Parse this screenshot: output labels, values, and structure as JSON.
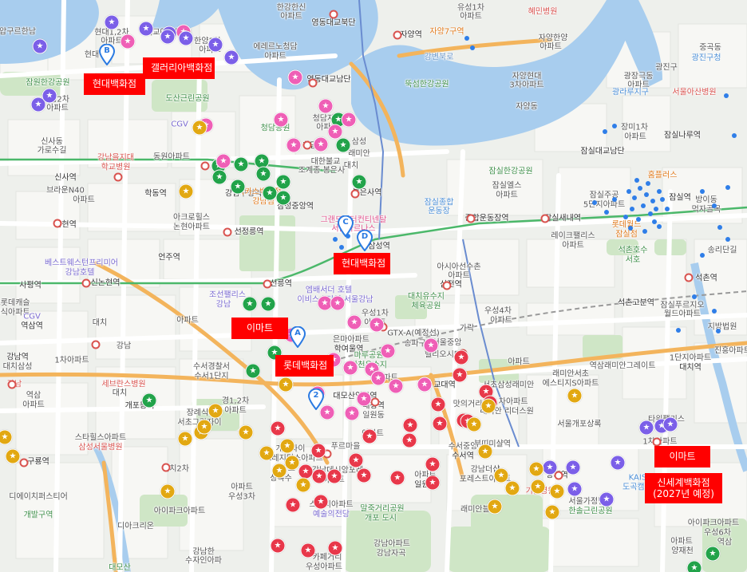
{
  "colors": {
    "land": "#eef0ec",
    "block": "#f6f6f3",
    "river": "#a8cdee",
    "park": "#cfe6c6",
    "road_major": "#ffffff",
    "road_orange": "#f3b45c",
    "line_green": "#4bb86a",
    "marker_green": "#22a34a",
    "marker_pink": "#ef5fb6",
    "marker_purple": "#7b5fe8",
    "marker_red": "#e8384a",
    "marker_yellow": "#e2a812",
    "callout_red": "#ff0000"
  },
  "callouts": [
    {
      "name": "callout-hyundai-apgujeong",
      "text": "현대백화점"
    },
    {
      "name": "callout-galleria",
      "text": "갤러리아백화점"
    },
    {
      "name": "callout-hyundai-coex",
      "text": "현대백화점"
    },
    {
      "name": "callout-emart-daechi",
      "text": "이마트"
    },
    {
      "name": "callout-lotte",
      "text": "롯데백화점"
    },
    {
      "name": "callout-emart-suseo",
      "text": "이마트"
    },
    {
      "name": "callout-shinsegae",
      "text": "신세계백화점\n(2027년 예정)"
    }
  ],
  "pins": [
    {
      "name": "pin-a",
      "letter": "A"
    },
    {
      "name": "pin-b",
      "letter": "B"
    },
    {
      "name": "pin-c",
      "letter": "C"
    },
    {
      "name": "pin-d",
      "letter": "D"
    },
    {
      "name": "pin-2",
      "letter": "2"
    }
  ],
  "marker_icon": "star-icon",
  "labels": [
    {
      "text": "압구르한남",
      "cls": ""
    },
    {
      "text": "현대1,2차",
      "cls": ""
    },
    {
      "text": "아파트",
      "cls": ""
    },
    {
      "text": "현대",
      "cls": ""
    },
    {
      "text": "대교아파트",
      "cls": ""
    },
    {
      "text": "한양1차",
      "cls": ""
    },
    {
      "text": "아파트",
      "cls": ""
    },
    {
      "text": "에레르노청담",
      "cls": ""
    },
    {
      "text": "아파트",
      "cls": ""
    },
    {
      "text": "한강한신",
      "cls": ""
    },
    {
      "text": "아파트",
      "cls": ""
    },
    {
      "text": "영동대교북단",
      "cls": "station"
    },
    {
      "text": "영동대교남단",
      "cls": "station"
    },
    {
      "text": "자양역",
      "cls": "station"
    },
    {
      "text": "자양7구역",
      "cls": "orange"
    },
    {
      "text": "유성1차",
      "cls": ""
    },
    {
      "text": "아파트",
      "cls": ""
    },
    {
      "text": "혜민병원",
      "cls": "hosp"
    },
    {
      "text": "자양한양",
      "cls": ""
    },
    {
      "text": "아파트",
      "cls": ""
    },
    {
      "text": "강변북로",
      "cls": "river"
    },
    {
      "text": "뚝섬한강공원",
      "cls": "park"
    },
    {
      "text": "자양현대",
      "cls": ""
    },
    {
      "text": "3차아파트",
      "cls": ""
    },
    {
      "text": "자양동",
      "cls": ""
    },
    {
      "text": "중곡동",
      "cls": ""
    },
    {
      "text": "광진구청",
      "cls": "area"
    },
    {
      "text": "광진구",
      "cls": ""
    },
    {
      "text": "광장극동",
      "cls": ""
    },
    {
      "text": "아파트",
      "cls": ""
    },
    {
      "text": "광라루지구",
      "cls": "area"
    },
    {
      "text": "서울아산병원",
      "cls": "hosp"
    },
    {
      "text": "잠원한강공원",
      "cls": "park"
    },
    {
      "text": "미성2차",
      "cls": ""
    },
    {
      "text": "아파트",
      "cls": ""
    },
    {
      "text": "도산근린공원",
      "cls": "park"
    },
    {
      "text": "신사동",
      "cls": ""
    },
    {
      "text": "가로수길",
      "cls": ""
    },
    {
      "text": "CGV",
      "cls": "purple"
    },
    {
      "text": "청담공원",
      "cls": "park"
    },
    {
      "text": "청담자이",
      "cls": ""
    },
    {
      "text": "아파트",
      "cls": ""
    },
    {
      "text": "청담역",
      "cls": "station"
    },
    {
      "text": "삼성",
      "cls": ""
    },
    {
      "text": "래미안",
      "cls": ""
    },
    {
      "text": "대치",
      "cls": ""
    },
    {
      "text": "장미1차",
      "cls": ""
    },
    {
      "text": "아파트",
      "cls": ""
    },
    {
      "text": "잠실나루역",
      "cls": "station"
    },
    {
      "text": "잠실대교남단",
      "cls": "station"
    },
    {
      "text": "잠실한강공원",
      "cls": "park"
    },
    {
      "text": "강남을지대",
      "cls": "hosp"
    },
    {
      "text": "학교병원",
      "cls": "hosp"
    },
    {
      "text": "동원아파트",
      "cls": ""
    },
    {
      "text": "대한불교",
      "cls": ""
    },
    {
      "text": "조계종 봉은사",
      "cls": ""
    },
    {
      "text": "홈플러스",
      "cls": "orange"
    },
    {
      "text": "잠실엘스",
      "cls": ""
    },
    {
      "text": "아파트",
      "cls": ""
    },
    {
      "text": "잠실주공",
      "cls": ""
    },
    {
      "text": "5단지아파트",
      "cls": ""
    },
    {
      "text": "잠실역",
      "cls": "station"
    },
    {
      "text": "방이동",
      "cls": ""
    },
    {
      "text": "먹자골목",
      "cls": ""
    },
    {
      "text": "신사역",
      "cls": "station"
    },
    {
      "text": "학동역",
      "cls": "station"
    },
    {
      "text": "강남구청역",
      "cls": "station"
    },
    {
      "text": "봉은사역",
      "cls": "station"
    },
    {
      "text": "잠실종합",
      "cls": "area"
    },
    {
      "text": "운동장",
      "cls": "area"
    },
    {
      "text": "종합운동장역",
      "cls": "station"
    },
    {
      "text": "잠실새내역",
      "cls": "station"
    },
    {
      "text": "브라운N40",
      "cls": ""
    },
    {
      "text": "아파트",
      "cls": ""
    },
    {
      "text": "카카스백화점",
      "cls": "orange"
    },
    {
      "text": "강남점",
      "cls": "orange"
    },
    {
      "text": "삼성중앙역",
      "cls": "station"
    },
    {
      "text": "그랜드인터컨티넨탈",
      "cls": "pink"
    },
    {
      "text": "서울파르나스",
      "cls": "pink"
    },
    {
      "text": "레이크팰리스",
      "cls": ""
    },
    {
      "text": "아파트",
      "cls": ""
    },
    {
      "text": "롯데월드",
      "cls": "orange"
    },
    {
      "text": "잠실점",
      "cls": "orange"
    },
    {
      "text": "논현역",
      "cls": "station"
    },
    {
      "text": "아크로힐스",
      "cls": ""
    },
    {
      "text": "논현아파트",
      "cls": ""
    },
    {
      "text": "선정릉역",
      "cls": "station"
    },
    {
      "text": "삼성역",
      "cls": "station"
    },
    {
      "text": "송리단길",
      "cls": ""
    },
    {
      "text": "석촌호수",
      "cls": "park"
    },
    {
      "text": "서호",
      "cls": "park"
    },
    {
      "text": "베스트웨스턴프리미어",
      "cls": "purple"
    },
    {
      "text": "강남호텔",
      "cls": "purple"
    },
    {
      "text": "언주역",
      "cls": "station"
    },
    {
      "text": "아시아선수촌",
      "cls": ""
    },
    {
      "text": "아파트",
      "cls": ""
    },
    {
      "text": "신논현역",
      "cls": "station"
    },
    {
      "text": "선릉역",
      "cls": "station"
    },
    {
      "text": "엠배서더 호텔",
      "cls": "purple"
    },
    {
      "text": "이비스스타일 서울강남",
      "cls": "purple"
    },
    {
      "text": "삼전역",
      "cls": "station"
    },
    {
      "text": "석촌역",
      "cls": "station"
    },
    {
      "text": "사평역",
      "cls": "station"
    },
    {
      "text": "조선팰리스",
      "cls": "purple"
    },
    {
      "text": "강남",
      "cls": "purple"
    },
    {
      "text": "대치유수지",
      "cls": "park"
    },
    {
      "text": "체육공원",
      "cls": "park"
    },
    {
      "text": "우성4차",
      "cls": ""
    },
    {
      "text": "아파트",
      "cls": ""
    },
    {
      "text": "석촌고분역",
      "cls": "station"
    },
    {
      "text": "잠실푸르지오",
      "cls": ""
    },
    {
      "text": "월드아파트",
      "cls": ""
    },
    {
      "text": "서초롯데캐슬",
      "cls": ""
    },
    {
      "text": "클래식아파트",
      "cls": ""
    },
    {
      "text": "CGV",
      "cls": "purple"
    },
    {
      "text": "역삼역",
      "cls": "station"
    },
    {
      "text": "대치",
      "cls": ""
    },
    {
      "text": "아파트",
      "cls": ""
    },
    {
      "text": "우성1차",
      "cls": ""
    },
    {
      "text": "아파트",
      "cls": ""
    },
    {
      "text": "GTX-A(예정선)",
      "cls": ""
    },
    {
      "text": "송파구",
      "cls": ""
    },
    {
      "text": "가락",
      "cls": ""
    },
    {
      "text": "서울중앙",
      "cls": ""
    },
    {
      "text": "지방법원",
      "cls": ""
    },
    {
      "text": "진흥아파트",
      "cls": ""
    },
    {
      "text": "강남역",
      "cls": "station"
    },
    {
      "text": "대치삼성",
      "cls": ""
    },
    {
      "text": "1차아파트",
      "cls": ""
    },
    {
      "text": "강남",
      "cls": ""
    },
    {
      "text": "은마아파트",
      "cls": ""
    },
    {
      "text": "학여울역",
      "cls": "station"
    },
    {
      "text": "마루공원",
      "cls": "park"
    },
    {
      "text": "탄천유수지",
      "cls": "park"
    },
    {
      "text": "헬리오시티",
      "cls": ""
    },
    {
      "text": "아파트",
      "cls": ""
    },
    {
      "text": "역삼래미안그레이트",
      "cls": ""
    },
    {
      "text": "1단지아파트",
      "cls": ""
    },
    {
      "text": "대치역",
      "cls": "station"
    },
    {
      "text": "수서경찰서",
      "cls": ""
    },
    {
      "text": "수서1단지",
      "cls": ""
    },
    {
      "text": "아파트",
      "cls": ""
    },
    {
      "text": "교대역",
      "cls": "station"
    },
    {
      "text": "래미안서초",
      "cls": ""
    },
    {
      "text": "에스티지S아파트",
      "cls": ""
    },
    {
      "text": "강남",
      "cls": "hosp"
    },
    {
      "text": "세브란스병원",
      "cls": "hosp"
    },
    {
      "text": "대치",
      "cls": ""
    },
    {
      "text": "경1,2차",
      "cls": ""
    },
    {
      "text": "아파트",
      "cls": ""
    },
    {
      "text": "대모산입구역",
      "cls": "station"
    },
    {
      "text": "대청역",
      "cls": "station"
    },
    {
      "text": "일원동",
      "cls": ""
    },
    {
      "text": "맛의거리",
      "cls": ""
    },
    {
      "text": "서초삼성래미안",
      "cls": ""
    },
    {
      "text": "1차아파트",
      "cls": ""
    },
    {
      "text": "래미안 리더스원",
      "cls": ""
    },
    {
      "text": "역삼",
      "cls": ""
    },
    {
      "text": "아파트",
      "cls": ""
    },
    {
      "text": "개포동역",
      "cls": "station"
    },
    {
      "text": "장례식장",
      "cls": ""
    },
    {
      "text": "서초그랑자이",
      "cls": ""
    },
    {
      "text": "아파트",
      "cls": ""
    },
    {
      "text": "서울개포상록",
      "cls": ""
    },
    {
      "text": "스타힐스아파트",
      "cls": ""
    },
    {
      "text": "삼성서울병원",
      "cls": "hosp"
    },
    {
      "text": "수서중앙",
      "cls": ""
    },
    {
      "text": "수서역",
      "cls": "station"
    },
    {
      "text": "부띠미샬역",
      "cls": ""
    },
    {
      "text": "타워팰리스",
      "cls": ""
    },
    {
      "text": "1차아파트",
      "cls": ""
    },
    {
      "text": "구룡역",
      "cls": "station"
    },
    {
      "text": "개포자이",
      "cls": ""
    },
    {
      "text": "프레지던스아파트",
      "cls": ""
    },
    {
      "text": "푸르마을",
      "cls": ""
    },
    {
      "text": "아파트",
      "cls": ""
    },
    {
      "text": "일원역",
      "cls": "station"
    },
    {
      "text": "강남더샵",
      "cls": ""
    },
    {
      "text": "포레스트아파트",
      "cls": ""
    },
    {
      "text": "양재역",
      "cls": "station"
    },
    {
      "text": "KAIST",
      "cls": "area"
    },
    {
      "text": "도곡캠퍼스",
      "cls": "area"
    },
    {
      "text": "대치2차",
      "cls": ""
    },
    {
      "text": "아파트",
      "cls": ""
    },
    {
      "text": "우성3차",
      "cls": ""
    },
    {
      "text": "아파트",
      "cls": ""
    },
    {
      "text": "상록수",
      "cls": ""
    },
    {
      "text": "강남데시앙포레",
      "cls": ""
    },
    {
      "text": "아파트",
      "cls": ""
    },
    {
      "text": "기쁨병원",
      "cls": "hosp"
    },
    {
      "text": "서울가정법원",
      "cls": ""
    },
    {
      "text": "한솔근린공원",
      "cls": "park"
    },
    {
      "text": "디에이치퍼스티어",
      "cls": ""
    },
    {
      "text": "아이파크아파트",
      "cls": ""
    },
    {
      "text": "래미안블레",
      "cls": ""
    },
    {
      "text": "스티지아파트",
      "cls": ""
    },
    {
      "text": "예술의전당",
      "cls": "purple"
    },
    {
      "text": "말죽거리공원",
      "cls": "park"
    },
    {
      "text": "개포 도시",
      "cls": "park"
    },
    {
      "text": "개발구역",
      "cls": "park"
    },
    {
      "text": "디아크리온",
      "cls": ""
    },
    {
      "text": "강남아파트",
      "cls": ""
    },
    {
      "text": "강남자곡",
      "cls": ""
    },
    {
      "text": "아이파크아파트",
      "cls": ""
    },
    {
      "text": "우성6차",
      "cls": ""
    },
    {
      "text": "아파트",
      "cls": ""
    },
    {
      "text": "양재천",
      "cls": ""
    },
    {
      "text": "카페거리",
      "cls": ""
    },
    {
      "text": "우성아파트",
      "cls": ""
    },
    {
      "text": "강남한",
      "cls": ""
    },
    {
      "text": "수자인아파",
      "cls": ""
    },
    {
      "text": "대모산",
      "cls": "park"
    },
    {
      "text": "역삼",
      "cls": ""
    }
  ]
}
